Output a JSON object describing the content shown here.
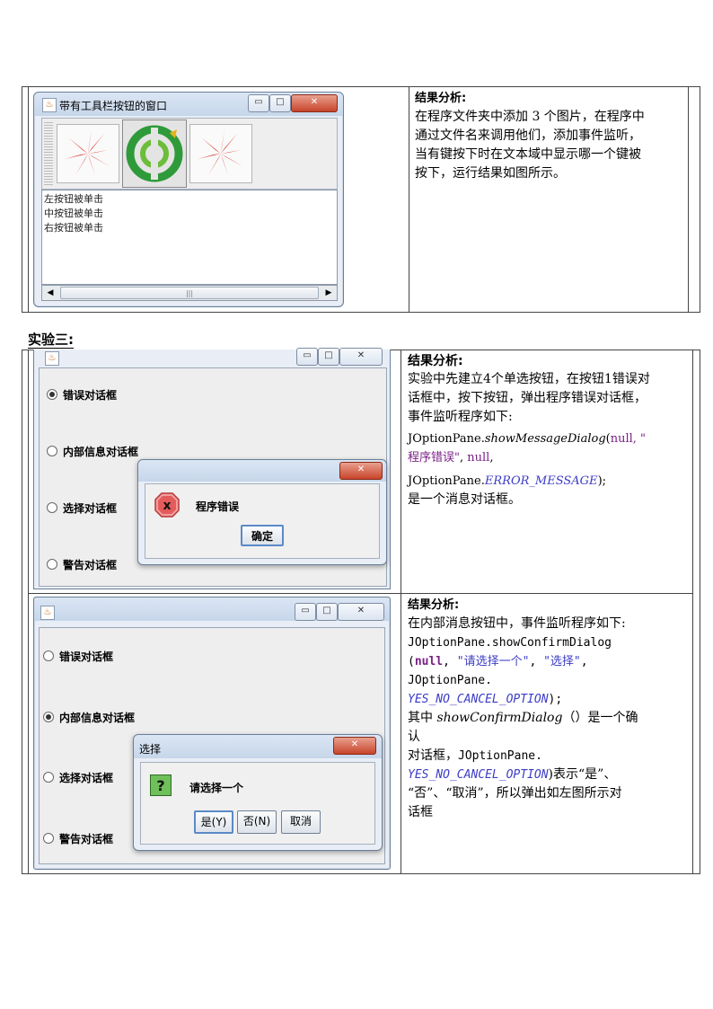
{
  "section_title": "实验三:",
  "row1": {
    "window_title": "带有工具栏按钮的窗口",
    "log_lines": [
      "左按钮被单击",
      "中按钮被单击",
      "右按钮被单击"
    ],
    "analysis_heading": "结果分析:",
    "analysis_lines": [
      "在程序文件夹中添加 3 个图片，在程序中",
      "通过文件名来调用他们，添加事件监听，",
      "当有键按下时在文本域中显示哪一个键被",
      "按下，运行结果如图所示。"
    ]
  },
  "row2": {
    "radios": [
      "错误对话框",
      "内部信息对话框",
      "选择对话框",
      "警告对话框"
    ],
    "dialog_message": "程序错误",
    "dialog_ok": "确定",
    "analysis_heading": "结果分析:",
    "analysis_lines": [
      "实验中先建立4个单选按钮，在按钮1错误对",
      "话框中，按下按钮，弹出程序错误对话框，",
      "事件监听程序如下:"
    ],
    "code_1a": "JOptionPane.",
    "code_1b": "showMessageDialog",
    "code_1c": "(",
    "code_1d": "null",
    "code_1e": ", \"",
    "code_2a": "程序错误\"",
    "code_2b": ", ",
    "code_2c": "null",
    "code_2d": ",",
    "code_3a": "JOptionPane.",
    "code_3b": "ERROR_MESSAGE",
    "code_3c": ");",
    "tail": "是一个消息对话框。"
  },
  "row3": {
    "radios": [
      "错误对话框",
      "内部信息对话框",
      "选择对话框",
      "警告对话框"
    ],
    "dialog_title": "选择",
    "dialog_message": "请选择一个",
    "btn_yes": "是(Y)",
    "btn_no": "否(N)",
    "btn_cancel": "取消",
    "analysis_heading": "结果分析:",
    "intro": "在内部消息按钮中，事件监听程序如下:",
    "code_1": "JOptionPane.showConfirmDialog",
    "code_2a": "(",
    "code_2b": "null",
    "code_2c": ", ",
    "code_2d": "\"请选择一个\"",
    "code_2e": ", ",
    "code_2f": "\"选择\"",
    "code_2g": ",",
    "code_3": "JOptionPane.",
    "code_4a": "YES_NO_CANCEL_OPTION",
    "code_4b": ");",
    "line5a": "其中 ",
    "line5b": "showConfirmDialog",
    "line5c": "（）是一个确",
    "line6": "认",
    "line7a": "对话框，",
    "line7b": "JOptionPane.",
    "line8a": "YES_NO_CANCEL_OPTION",
    "line8b": ")表示“是”、",
    "line9": "“否”、“取消”，所以弹出如左图所示对",
    "line10": "话框"
  }
}
